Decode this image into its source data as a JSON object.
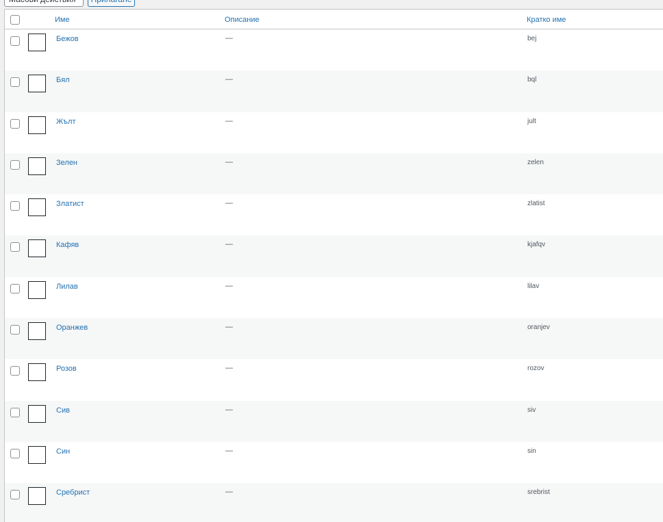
{
  "toolbar": {
    "bulk_actions_label": "Масови действия",
    "apply_label": "Прилагане"
  },
  "table": {
    "columns": {
      "name": "Име",
      "description": "Описание",
      "slug": "Кратко име"
    },
    "rows": [
      {
        "name": "Бежов",
        "description": "—",
        "slug": "bej"
      },
      {
        "name": "Бял",
        "description": "—",
        "slug": "bql"
      },
      {
        "name": "Жълт",
        "description": "—",
        "slug": "jult"
      },
      {
        "name": "Зелен",
        "description": "—",
        "slug": "zelen"
      },
      {
        "name": "Златист",
        "description": "—",
        "slug": "zlatist"
      },
      {
        "name": "Кафяв",
        "description": "—",
        "slug": "kjafqv"
      },
      {
        "name": "Лилав",
        "description": "—",
        "slug": "lilav"
      },
      {
        "name": "Оранжев",
        "description": "—",
        "slug": "oranjev"
      },
      {
        "name": "Розов",
        "description": "—",
        "slug": "rozov"
      },
      {
        "name": "Сив",
        "description": "—",
        "slug": "siv"
      },
      {
        "name": "Син",
        "description": "—",
        "slug": "sin"
      },
      {
        "name": "Сребрист",
        "description": "—",
        "slug": "srebrist"
      }
    ]
  }
}
